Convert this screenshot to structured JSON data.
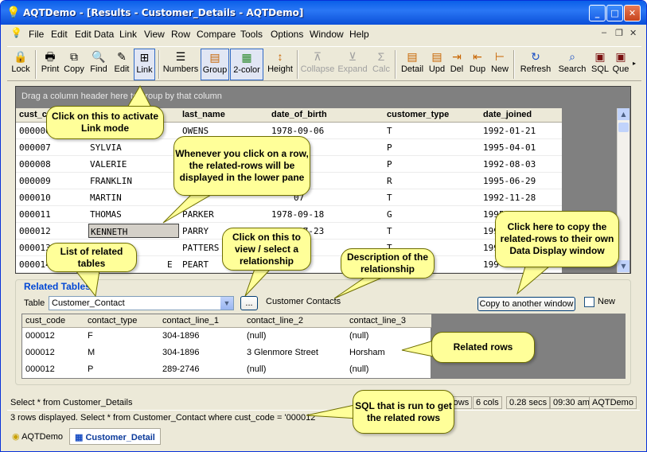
{
  "window": {
    "title": "AQTDemo - [Results - Customer_Details - AQTDemo]"
  },
  "menu": [
    "File",
    "Edit",
    "Edit Data",
    "Link",
    "View",
    "Row",
    "Compare",
    "Tools",
    "Options",
    "Window",
    "Help"
  ],
  "toolbar": [
    {
      "label": "Lock",
      "icon": "🔒"
    },
    {
      "label": "Print",
      "icon": "🖶"
    },
    {
      "label": "Copy",
      "icon": "⧉"
    },
    {
      "label": "Find",
      "icon": "🔍"
    },
    {
      "label": "Edit",
      "icon": "✎"
    },
    {
      "label": "Link",
      "icon": "⊞"
    },
    {
      "label": "Numbers",
      "icon": "☰"
    },
    {
      "label": "Group",
      "icon": "▤"
    },
    {
      "label": "2-color",
      "icon": "▦"
    },
    {
      "label": "Height",
      "icon": "↕"
    },
    {
      "label": "Collapse",
      "icon": "⊼"
    },
    {
      "label": "Expand",
      "icon": "⊻"
    },
    {
      "label": "Calc",
      "icon": "Σ"
    },
    {
      "label": "Detail",
      "icon": "▤"
    },
    {
      "label": "Upd",
      "icon": "▤"
    },
    {
      "label": "Del",
      "icon": "⇥"
    },
    {
      "label": "Dup",
      "icon": "⇤"
    },
    {
      "label": "New",
      "icon": "⊢"
    },
    {
      "label": "Refresh",
      "icon": "↻"
    },
    {
      "label": "Search",
      "icon": "⌕"
    },
    {
      "label": "SQL",
      "icon": "▣"
    },
    {
      "label": "Que",
      "icon": "▣"
    }
  ],
  "grid": {
    "group_hint": "Drag a column header here to group by that column",
    "columns": [
      "cust_c",
      "",
      "last_name",
      "date_of_birth",
      "customer_type",
      "date_joined"
    ],
    "rows": [
      [
        "000006",
        "",
        "OWENS",
        "1978-09-06",
        "T",
        "1992-01-21"
      ],
      [
        "000007",
        "SYLVIA",
        "",
        "17",
        "P",
        "1995-04-01"
      ],
      [
        "000008",
        "VALERIE",
        "",
        "24",
        "P",
        "1992-08-03"
      ],
      [
        "000009",
        "FRANKLIN",
        "",
        "21",
        "R",
        "1995-06-29"
      ],
      [
        "000010",
        "MARTIN",
        "",
        "07",
        "T",
        "1992-11-28"
      ],
      [
        "000011",
        "THOMAS",
        "PARKER",
        "1978-09-18",
        "G",
        "1995-07-08"
      ],
      [
        "000012",
        "KENNETH",
        "PARRY",
        "1981-07-23",
        "T",
        "199"
      ],
      [
        "000013",
        "",
        "PATTERS",
        "",
        "T",
        "199"
      ],
      [
        "000014",
        "E",
        "PEART",
        "",
        "T",
        "199"
      ]
    ]
  },
  "related": {
    "legend": "Related Tables",
    "table_label": "Table",
    "table_value": "Customer_Contact",
    "browse_label": "...",
    "description": "Customer Contacts",
    "copy_button": "Copy to another window",
    "new_label": "New",
    "columns": [
      "cust_code",
      "contact_type",
      "contact_line_1",
      "contact_line_2",
      "contact_line_3"
    ],
    "rows": [
      [
        "000012",
        "F",
        "304-1896",
        "(null)",
        "(null)"
      ],
      [
        "000012",
        "M",
        "304-1896",
        "3 Glenmore  Street",
        "Horsham"
      ],
      [
        "000012",
        "P",
        "289-2746",
        "(null)",
        "(null)"
      ]
    ]
  },
  "status": {
    "line1": "Select * from Customer_Details",
    "rows_panel": "rows",
    "cols": "6 cols",
    "secs": "0.28 secs",
    "time": "09:30 am",
    "app": "AQTDemo",
    "line2": "3 rows displayed. Select * from Customer_Contact where cust_code = '000012'"
  },
  "tabs": [
    "AQTDemo",
    "Customer_Detail"
  ],
  "callouts": {
    "link": "Click on this to activate Link mode",
    "row": "Whenever you click on a row, the related-rows will be displayed in the lower pane",
    "list": "List of related tables",
    "view": "Click on this to view / select a relationship",
    "desc": "Description of the relationship",
    "copy": "Click here to copy the related-rows to their own Data Display window",
    "rows": "Related rows",
    "sql": "SQL that is run to get the related rows"
  }
}
